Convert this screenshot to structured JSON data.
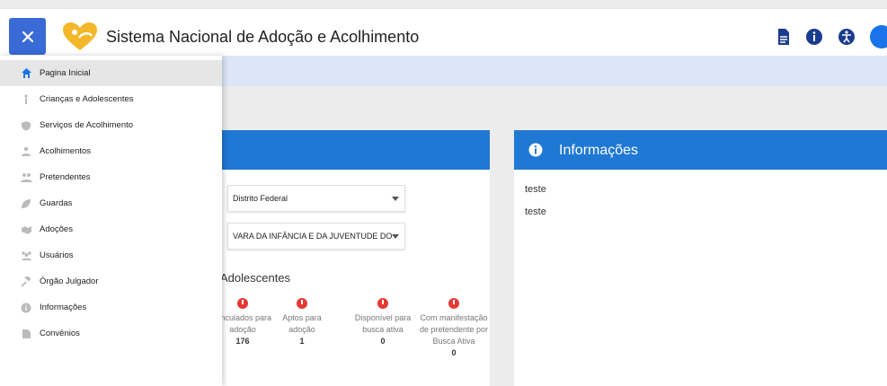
{
  "header": {
    "title": "Sistema Nacional de Adoção e Acolhimento",
    "close_icon": "close-icon",
    "icons": [
      "document-icon",
      "info-icon",
      "accessibility-icon",
      "user-icon"
    ]
  },
  "sidebar": {
    "items": [
      {
        "label": "Pagina Inicial",
        "icon": "home-icon",
        "active": true
      },
      {
        "label": "Crianças e Adolescentes",
        "icon": "child-icon"
      },
      {
        "label": "Serviços de Acolhimento",
        "icon": "shield-icon"
      },
      {
        "label": "Acolhimentos",
        "icon": "person-icon"
      },
      {
        "label": "Pretendentes",
        "icon": "group-icon"
      },
      {
        "label": "Guardas",
        "icon": "leaf-icon"
      },
      {
        "label": "Adoções",
        "icon": "handshake-icon"
      },
      {
        "label": "Usuários",
        "icon": "users-icon"
      },
      {
        "label": "Órgão Julgador",
        "icon": "gavel-icon"
      },
      {
        "label": "Informações",
        "icon": "info-circle-icon"
      },
      {
        "label": "Convênios",
        "icon": "file-icon"
      }
    ]
  },
  "filters": {
    "state": "Distrito Federal",
    "court": "VARA DA INFÂNCIA E DA JUVENTUDE DO DF"
  },
  "stats": {
    "section_title": "Adolescentes",
    "items": [
      {
        "label": "...nculados para adoção",
        "value": "176"
      },
      {
        "label": "Aptos para adoção",
        "value": "1"
      },
      {
        "label": "Disponível para busca ativa",
        "value": "0"
      },
      {
        "label": "Com manifestação de pretendente por Busca Ativa",
        "value": "0"
      }
    ]
  },
  "info_panel": {
    "title": "Informações",
    "lines": [
      "teste",
      "teste"
    ]
  },
  "colors": {
    "primary": "#1f78d4",
    "close_bg": "#3a6ad6",
    "stat_dot": "#e53935",
    "logo": "#f4b72a"
  }
}
